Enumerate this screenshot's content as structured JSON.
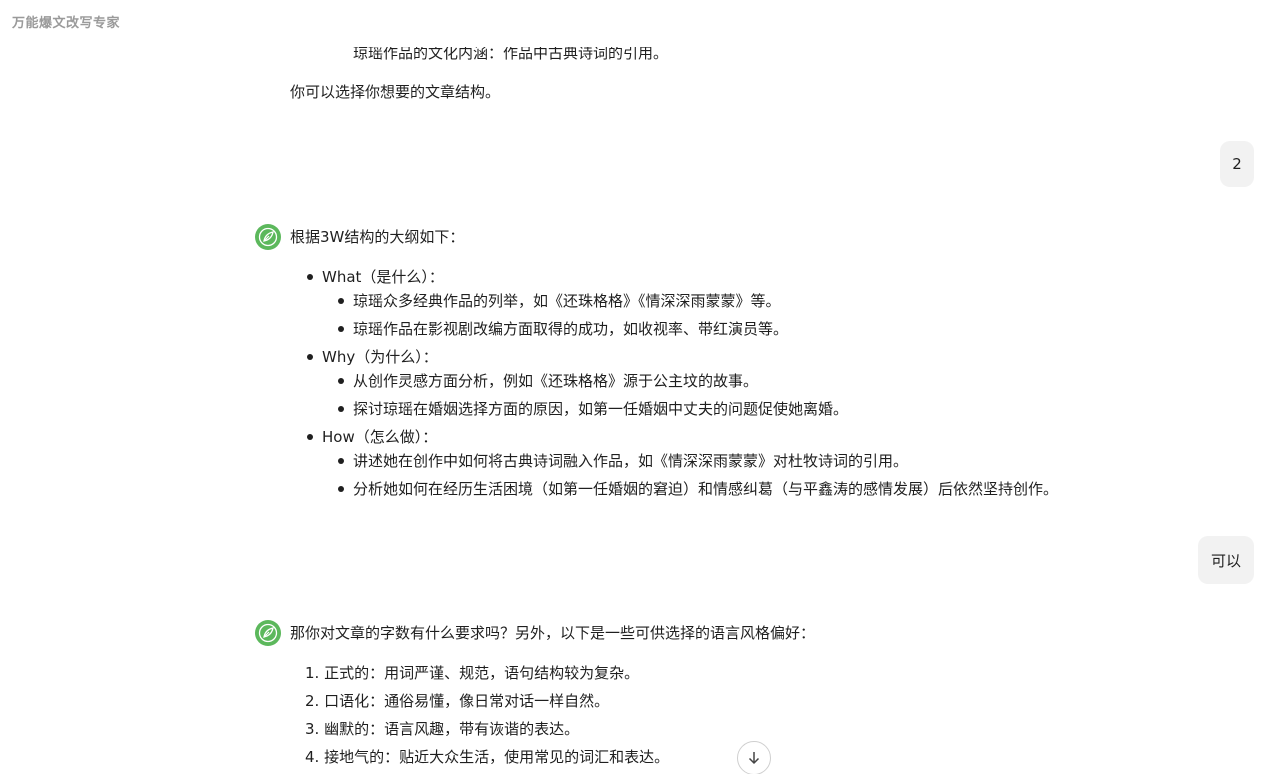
{
  "app": {
    "title": "万能爆文改写专家"
  },
  "messages": {
    "m0": {
      "partial_item": "琼瑶作品的文化内涵：作品中古典诗词的引用。",
      "closing": "你可以选择你想要的文章结构。"
    },
    "u1": {
      "text": "2"
    },
    "m1": {
      "intro": "根据3W结构的大纲如下：",
      "sections": [
        {
          "title": "What（是什么）：",
          "items": [
            "琼瑶众多经典作品的列举，如《还珠格格》《情深深雨蒙蒙》等。",
            "琼瑶作品在影视剧改编方面取得的成功，如收视率、带红演员等。"
          ]
        },
        {
          "title": "Why（为什么）：",
          "items": [
            "从创作灵感方面分析，例如《还珠格格》源于公主坟的故事。",
            "探讨琼瑶在婚姻选择方面的原因，如第一任婚姻中丈夫的问题促使她离婚。"
          ]
        },
        {
          "title": "How（怎么做）：",
          "items": [
            "讲述她在创作中如何将古典诗词融入作品，如《情深深雨蒙蒙》对杜牧诗词的引用。",
            "分析她如何在经历生活困境（如第一任婚姻的窘迫）和情感纠葛（与平鑫涛的感情发展）后依然坚持创作。"
          ]
        }
      ]
    },
    "u2": {
      "text": "可以"
    },
    "m2": {
      "intro": "那你对文章的字数有什么要求吗？另外，以下是一些可供选择的语言风格偏好：",
      "styles": [
        "1. 正式的：用词严谨、规范，语句结构较为复杂。",
        "2. 口语化：通俗易懂，像日常对话一样自然。",
        "3. 幽默的：语言风趣，带有诙谐的表达。",
        "4. 接地气的：贴近大众生活，使用常见的词汇和表达。"
      ]
    }
  },
  "colors": {
    "avatar": "#5cb85c",
    "bubble": "#f2f2f2",
    "title": "#9a9a9a"
  },
  "icons": {
    "avatar": "leaf-logo-icon",
    "scroll": "arrow-down-icon"
  }
}
